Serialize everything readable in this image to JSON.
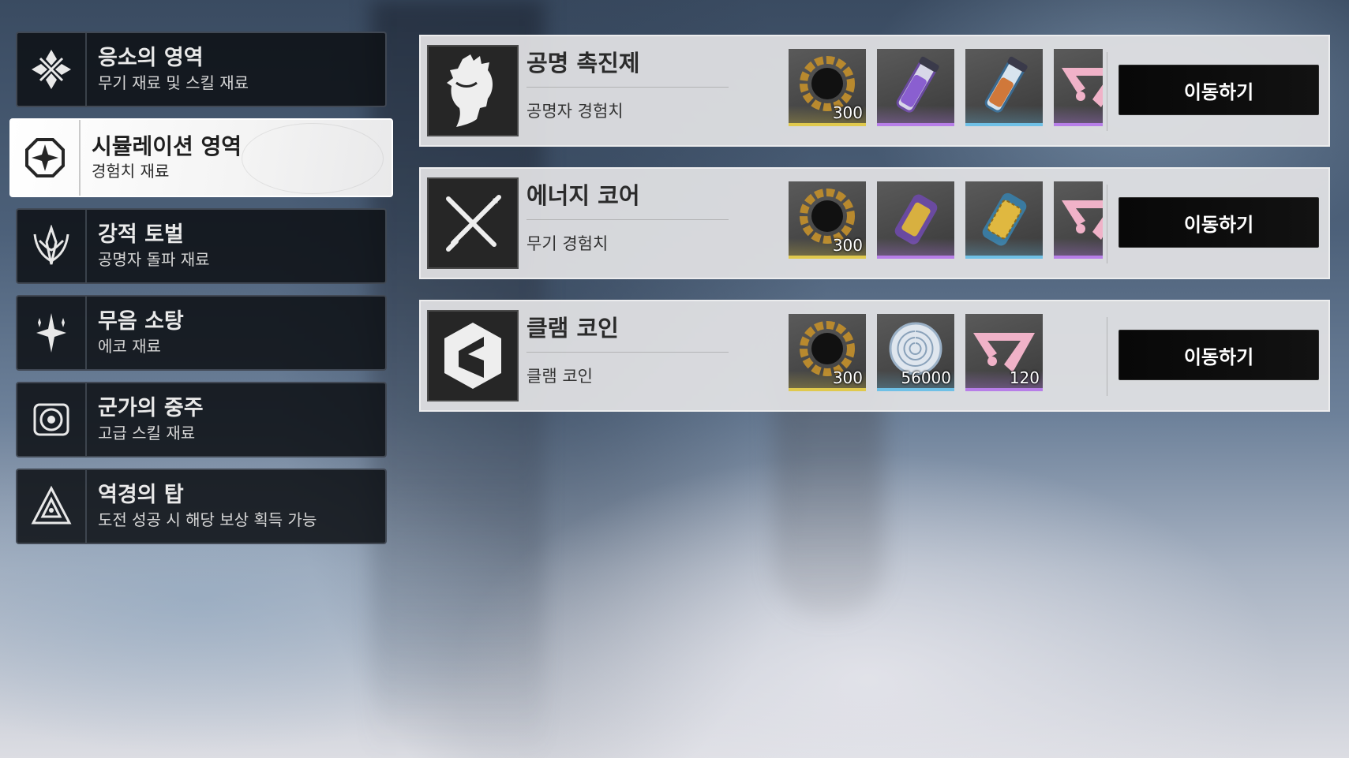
{
  "sidebar": {
    "items": [
      {
        "title": "응소의 영역",
        "sub": "무기 재료 및 스킬 재료",
        "icon": "diamond-cross-icon",
        "active": false
      },
      {
        "title": "시뮬레이션 영역",
        "sub": "경험치 재료",
        "icon": "octagon-star-icon",
        "active": true
      },
      {
        "title": "강적 토벌",
        "sub": "공명자 돌파 재료",
        "icon": "flame-crest-icon",
        "active": false
      },
      {
        "title": "무음 소탕",
        "sub": "에코 재료",
        "icon": "sparkle-icon",
        "active": false
      },
      {
        "title": "군가의 중주",
        "sub": "고급 스킬 재료",
        "icon": "target-ring-icon",
        "active": false
      },
      {
        "title": "역경의 탑",
        "sub": "도전 성공 시 해당 보상 획득 가능",
        "icon": "triangle-tower-icon",
        "active": false
      }
    ]
  },
  "cards": [
    {
      "title": "공명 촉진제",
      "sub": "공명자 경험치",
      "icon": "resonator-head-icon",
      "button": "이동하기",
      "rewards": [
        {
          "icon": "ring-coin-icon",
          "qty": "300",
          "tier": "gold"
        },
        {
          "icon": "purple-vial-icon",
          "qty": "",
          "tier": "purple"
        },
        {
          "icon": "blue-vial-icon",
          "qty": "",
          "tier": "blue"
        },
        {
          "icon": "pink-emblem-icon",
          "qty": "",
          "tier": "purple"
        }
      ]
    },
    {
      "title": "에너지 코어",
      "sub": "무기 경험치",
      "icon": "crossed-swords-icon",
      "button": "이동하기",
      "rewards": [
        {
          "icon": "ring-coin-icon",
          "qty": "300",
          "tier": "gold"
        },
        {
          "icon": "purple-core-icon",
          "qty": "",
          "tier": "purple"
        },
        {
          "icon": "blue-core-icon",
          "qty": "",
          "tier": "blue"
        },
        {
          "icon": "pink-emblem-icon",
          "qty": "",
          "tier": "purple"
        }
      ]
    },
    {
      "title": "클램 코인",
      "sub": "클램 코인",
      "icon": "shell-hexagon-icon",
      "button": "이동하기",
      "rewards": [
        {
          "icon": "ring-coin-icon",
          "qty": "300",
          "tier": "gold"
        },
        {
          "icon": "shell-coin-icon",
          "qty": "56000",
          "tier": "blue"
        },
        {
          "icon": "pink-emblem-icon",
          "qty": "120",
          "tier": "purple"
        }
      ]
    }
  ]
}
